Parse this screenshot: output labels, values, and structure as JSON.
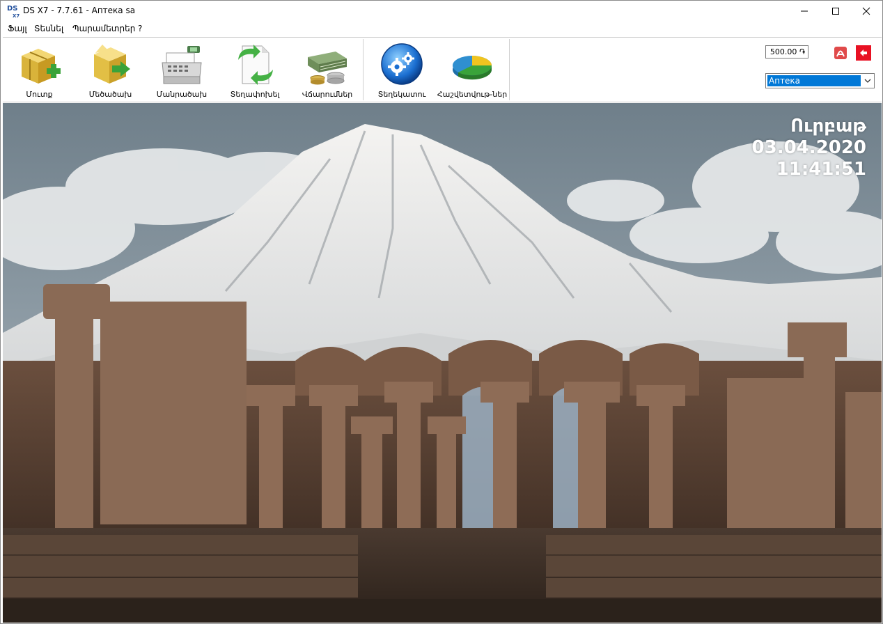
{
  "window": {
    "title": "DS X7 - 7.7.61 - Аптека sa",
    "app_icon": "ds-x7-logo",
    "controls": [
      "minimize-icon",
      "maximize-icon",
      "close-icon"
    ]
  },
  "menu": {
    "items": [
      "Ֆայլ",
      "Տեսնել",
      "Պարամետրեր",
      "?"
    ]
  },
  "toolbar": {
    "buttons": [
      {
        "label": "Մուտք",
        "icon": "box-add-icon"
      },
      {
        "label": "Մեծածախ",
        "icon": "box-export-icon"
      },
      {
        "label": "Մանրածախ",
        "icon": "cash-register-icon"
      },
      {
        "label": "Տեղափոխել",
        "icon": "document-transfer-icon"
      },
      {
        "label": "Վճարումներ",
        "icon": "money-stack-icon"
      },
      {
        "label": "Տեղեկատու",
        "icon": "gears-icon"
      },
      {
        "label": "Հաշվետվութ-ներ",
        "icon": "pie-chart-icon"
      }
    ],
    "amount": "500.00 ֏",
    "store_select": {
      "value": "Аптека"
    }
  },
  "status": {
    "day": "Ուրբաթ",
    "date": "03.04.2020",
    "time": "11:41:51"
  },
  "colors": {
    "selection": "#0078d7",
    "close_accent": "#e81123",
    "sky": "#7a8a95"
  }
}
